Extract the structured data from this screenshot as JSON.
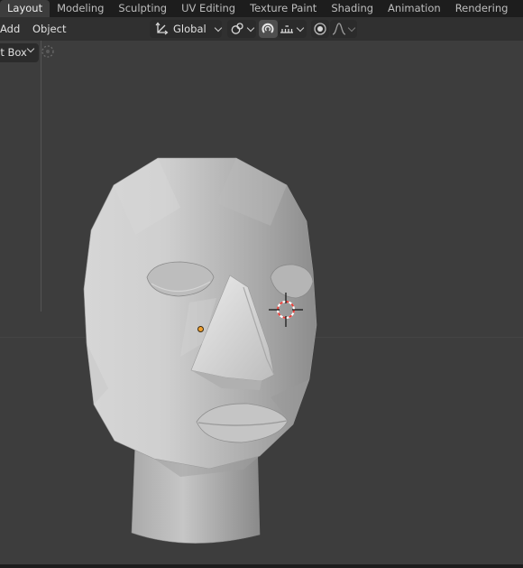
{
  "workspace_tabs": [
    {
      "label": "Layout",
      "active": true
    },
    {
      "label": "Modeling",
      "active": false
    },
    {
      "label": "Sculpting",
      "active": false
    },
    {
      "label": "UV Editing",
      "active": false
    },
    {
      "label": "Texture Paint",
      "active": false
    },
    {
      "label": "Shading",
      "active": false
    },
    {
      "label": "Animation",
      "active": false
    },
    {
      "label": "Rendering",
      "active": false
    }
  ],
  "viewport_header": {
    "menus": {
      "add": "Add",
      "object": "Object"
    },
    "select_mode": "ct Box",
    "transform_orientation": "Global",
    "icons": {
      "orientation": "transform-orientation-icon",
      "pivot": "pivot-point-icon",
      "snap": "snap-magnet-icon",
      "snap_target": "snap-increment-icon",
      "proportional": "proportional-editing-icon",
      "falloff": "falloff-curve-icon",
      "tweak": "tweak-tool-icon"
    }
  },
  "colors": {
    "viewport_bg": "#3d3d3d",
    "tab_bar_bg": "#1d1d1d",
    "header_bg": "#303030",
    "active_snap_button": "#4f4f4f",
    "origin_point": "#f0a030",
    "cursor_ring_red": "#e8403a",
    "mesh_gray": "#a6a6a6"
  }
}
